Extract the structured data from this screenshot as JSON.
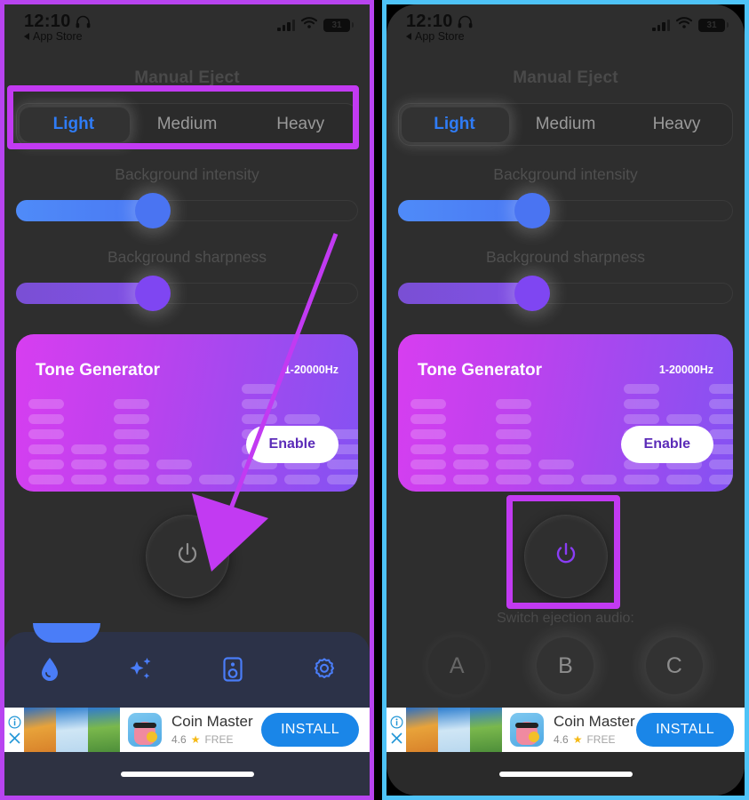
{
  "statusbar": {
    "time": "12:10",
    "back_label": "App Store",
    "battery_level": "31",
    "headphone_icon": "headphone-icon",
    "signal_icon": "cellular-bars-icon",
    "wifi_icon": "wifi-icon"
  },
  "app": {
    "section_title": "Manual Eject",
    "segments": [
      {
        "label": "Light",
        "selected": true
      },
      {
        "label": "Medium",
        "selected": false
      },
      {
        "label": "Heavy",
        "selected": false
      }
    ],
    "sliders": [
      {
        "label": "Background intensity",
        "value": 40,
        "color": "#4a74f2"
      },
      {
        "label": "Background sharpness",
        "value": 40,
        "color": "#7f46f2"
      }
    ],
    "tone_card": {
      "title": "Tone Generator",
      "range": "1-20000Hz",
      "button": "Enable"
    },
    "power_button_icon": "power-icon",
    "switch_label": "Switch ejection audio:",
    "audio_buttons": [
      "A",
      "B",
      "C"
    ],
    "tabs": [
      {
        "icon": "water-drop-icon"
      },
      {
        "icon": "sparkles-icon"
      },
      {
        "icon": "speaker-icon"
      },
      {
        "icon": "gear-icon"
      }
    ]
  },
  "ad": {
    "title": "Coin Master",
    "rating": "4.6",
    "price": "FREE",
    "install_label": "INSTALL",
    "info_icon": "info-icon",
    "close_icon": "close-icon"
  },
  "annotations": {
    "highlight_color": "#c23af2",
    "left_border_color": "#b844f0",
    "right_border_color": "#4ec3f7",
    "left_highlight_target": "segmented-control",
    "right_highlight_target": "power-button",
    "arrow": "points-to-power-button"
  }
}
